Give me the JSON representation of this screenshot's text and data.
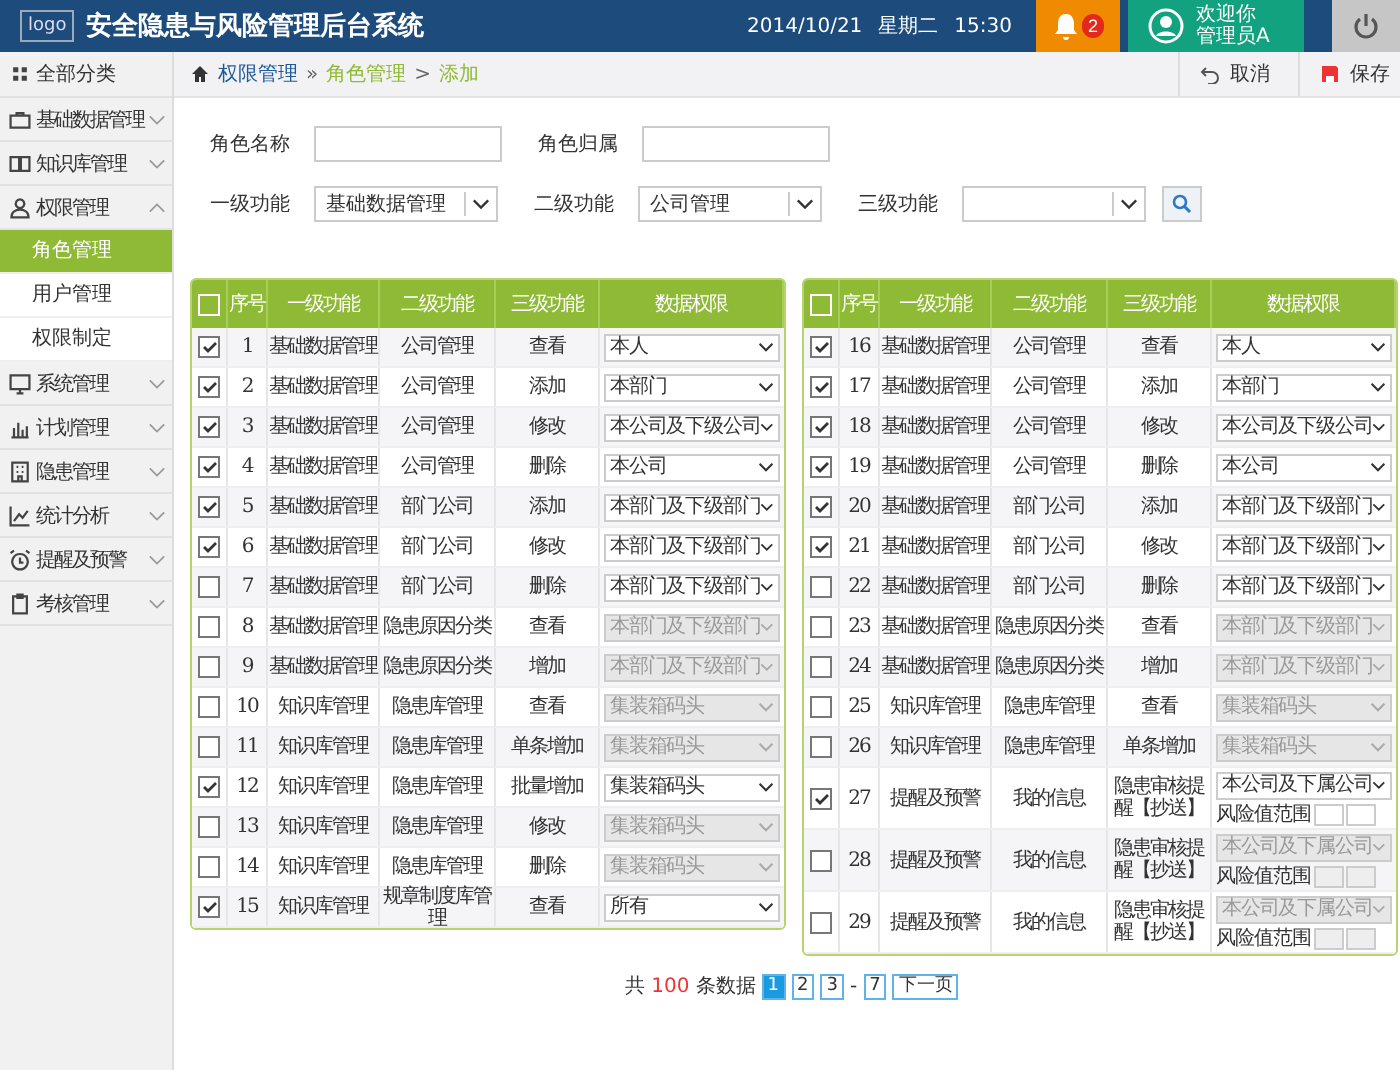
{
  "header": {
    "logo": "logo",
    "title": "安全隐患与风险管理后台系统",
    "date": "2014/10/21",
    "weekday": "星期二",
    "time": "15:30",
    "notification_count": "2",
    "welcome": "欢迎你",
    "user": "管理员A"
  },
  "sidebar": {
    "title": "全部分类",
    "items": [
      {
        "label": "基础数据管理",
        "expanded": false
      },
      {
        "label": "知识库管理",
        "expanded": false
      },
      {
        "label": "权限管理",
        "expanded": true,
        "children": [
          {
            "label": "角色管理",
            "selected": true
          },
          {
            "label": "用户管理",
            "selected": false
          },
          {
            "label": "权限制定",
            "selected": false
          }
        ]
      },
      {
        "label": "系统管理",
        "expanded": false
      },
      {
        "label": "计划管理",
        "expanded": false
      },
      {
        "label": "隐患管理",
        "expanded": false
      },
      {
        "label": "统计分析",
        "expanded": false
      },
      {
        "label": "提醒及预警",
        "expanded": false
      },
      {
        "label": "考核管理",
        "expanded": false
      }
    ]
  },
  "breadcrumb": [
    {
      "label": "权限管理"
    },
    {
      "separator": "»",
      "label": "角色管理"
    },
    {
      "separator": ">",
      "label": "添加"
    }
  ],
  "actions": [
    "取消",
    "保存"
  ],
  "form": {
    "role_name": {
      "label": "角色名称"
    },
    "role_owner": {
      "label": "角色归属"
    },
    "filters": [
      {
        "label": "一级功能",
        "value": "基础数据管理"
      },
      {
        "label": "二级功能",
        "value": "公司管理"
      },
      {
        "label": "三级功能"
      }
    ]
  },
  "tables": [
    {
      "header_checked": false,
      "columns": [
        "序号",
        "一级功能",
        "二级功能",
        "三级功能",
        "数据权限"
      ],
      "rows": [
        {
          "checked": true,
          "no": "1",
          "l1": "基础数据管理",
          "l2": "公司管理",
          "l3": "查看",
          "perm": "本人",
          "disabled": false
        },
        {
          "checked": true,
          "no": "2",
          "l1": "基础数据管理",
          "l2": "公司管理",
          "l3": "添加",
          "perm": "本部门",
          "disabled": false
        },
        {
          "checked": true,
          "no": "3",
          "l1": "基础数据管理",
          "l2": "公司管理",
          "l3": "修改",
          "perm": "本公司及下级公司",
          "disabled": false
        },
        {
          "checked": true,
          "no": "4",
          "l1": "基础数据管理",
          "l2": "公司管理",
          "l3": "删除",
          "perm": "本公司",
          "disabled": false
        },
        {
          "checked": true,
          "no": "5",
          "l1": "基础数据管理",
          "l2": "部门公司",
          "l3": "添加",
          "perm": "本部门及下级部门",
          "disabled": false
        },
        {
          "checked": true,
          "no": "6",
          "l1": "基础数据管理",
          "l2": "部门公司",
          "l3": "修改",
          "perm": "本部门及下级部门",
          "disabled": false
        },
        {
          "checked": false,
          "no": "7",
          "l1": "基础数据管理",
          "l2": "部门公司",
          "l3": "删除",
          "perm": "本部门及下级部门",
          "disabled": false
        },
        {
          "checked": false,
          "no": "8",
          "l1": "基础数据管理",
          "l2": "隐患原因分类",
          "l3": "查看",
          "perm": "本部门及下级部门",
          "disabled": true
        },
        {
          "checked": false,
          "no": "9",
          "l1": "基础数据管理",
          "l2": "隐患原因分类",
          "l3": "增加",
          "perm": "本部门及下级部门",
          "disabled": true
        },
        {
          "checked": false,
          "no": "10",
          "l1": "知识库管理",
          "l2": "隐患库管理",
          "l3": "查看",
          "perm": "集装箱码头",
          "disabled": true
        },
        {
          "checked": false,
          "no": "11",
          "l1": "知识库管理",
          "l2": "隐患库管理",
          "l3": "单条增加",
          "perm": "集装箱码头",
          "disabled": true
        },
        {
          "checked": true,
          "no": "12",
          "l1": "知识库管理",
          "l2": "隐患库管理",
          "l3": "批量增加",
          "perm": "集装箱码头",
          "disabled": false
        },
        {
          "checked": false,
          "no": "13",
          "l1": "知识库管理",
          "l2": "隐患库管理",
          "l3": "修改",
          "perm": "集装箱码头",
          "disabled": true
        },
        {
          "checked": false,
          "no": "14",
          "l1": "知识库管理",
          "l2": "隐患库管理",
          "l3": "删除",
          "perm": "集装箱码头",
          "disabled": true
        },
        {
          "checked": true,
          "no": "15",
          "l1": "知识库管理",
          "l2": "规章制度库管理",
          "l3": "查看",
          "perm": "所有",
          "disabled": false
        }
      ]
    },
    {
      "header_checked": false,
      "columns": [
        "序号",
        "一级功能",
        "二级功能",
        "三级功能",
        "数据权限"
      ],
      "rows": [
        {
          "checked": true,
          "no": "16",
          "l1": "基础数据管理",
          "l2": "公司管理",
          "l3": "查看",
          "perm": "本人",
          "disabled": false
        },
        {
          "checked": true,
          "no": "17",
          "l1": "基础数据管理",
          "l2": "公司管理",
          "l3": "添加",
          "perm": "本部门",
          "disabled": false
        },
        {
          "checked": true,
          "no": "18",
          "l1": "基础数据管理",
          "l2": "公司管理",
          "l3": "修改",
          "perm": "本公司及下级公司",
          "disabled": false
        },
        {
          "checked": true,
          "no": "19",
          "l1": "基础数据管理",
          "l2": "公司管理",
          "l3": "删除",
          "perm": "本公司",
          "disabled": false
        },
        {
          "checked": true,
          "no": "20",
          "l1": "基础数据管理",
          "l2": "部门公司",
          "l3": "添加",
          "perm": "本部门及下级部门",
          "disabled": false
        },
        {
          "checked": true,
          "no": "21",
          "l1": "基础数据管理",
          "l2": "部门公司",
          "l3": "修改",
          "perm": "本部门及下级部门",
          "disabled": false
        },
        {
          "checked": false,
          "no": "22",
          "l1": "基础数据管理",
          "l2": "部门公司",
          "l3": "删除",
          "perm": "本部门及下级部门",
          "disabled": false
        },
        {
          "checked": false,
          "no": "23",
          "l1": "基础数据管理",
          "l2": "隐患原因分类",
          "l3": "查看",
          "perm": "本部门及下级部门",
          "disabled": true
        },
        {
          "checked": false,
          "no": "24",
          "l1": "基础数据管理",
          "l2": "隐患原因分类",
          "l3": "增加",
          "perm": "本部门及下级部门",
          "disabled": true
        },
        {
          "checked": false,
          "no": "25",
          "l1": "知识库管理",
          "l2": "隐患库管理",
          "l3": "查看",
          "perm": "集装箱码头",
          "disabled": true
        },
        {
          "checked": false,
          "no": "26",
          "l1": "知识库管理",
          "l2": "隐患库管理",
          "l3": "单条增加",
          "perm": "集装箱码头",
          "disabled": true
        },
        {
          "checked": true,
          "no": "27",
          "l1": "提醒及预警",
          "l2": "我的信息",
          "l3": "隐患审核提醒【抄送】",
          "perm": "本公司及下属公司",
          "disabled": false,
          "range_label": "风险值范围"
        },
        {
          "checked": false,
          "no": "28",
          "l1": "提醒及预警",
          "l2": "我的信息",
          "l3": "隐患审核提醒【抄送】",
          "perm": "本公司及下属公司",
          "disabled": true,
          "range_label": "风险值范围"
        },
        {
          "checked": false,
          "no": "29",
          "l1": "提醒及预警",
          "l2": "我的信息",
          "l3": "隐患审核提醒【抄送】",
          "perm": "本公司及下属公司",
          "disabled": true,
          "range_label": "风险值范围"
        }
      ]
    }
  ],
  "pagination": {
    "prefix": "共",
    "total": "100",
    "suffix": "条数据",
    "pages": [
      {
        "label": "1",
        "selected": true
      },
      {
        "label": "2",
        "selected": false
      },
      {
        "label": "3",
        "selected": false
      },
      {
        "label": "7",
        "selected": false
      }
    ],
    "gap": "-",
    "next": "下一页"
  }
}
